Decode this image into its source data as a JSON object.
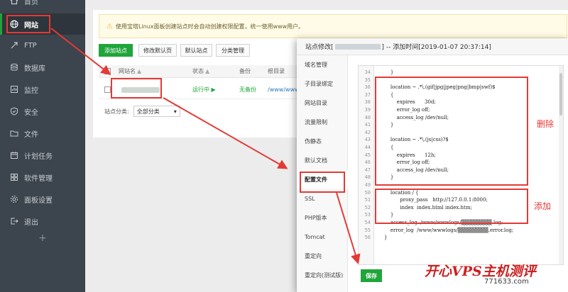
{
  "sidebar": {
    "items": [
      {
        "label": "首页",
        "icon": "home-icon"
      },
      {
        "label": "网站",
        "icon": "globe-icon"
      },
      {
        "label": "FTP",
        "icon": "ftp-icon"
      },
      {
        "label": "数据库",
        "icon": "database-icon"
      },
      {
        "label": "监控",
        "icon": "monitor-icon"
      },
      {
        "label": "安全",
        "icon": "shield-icon"
      },
      {
        "label": "文件",
        "icon": "folder-icon"
      },
      {
        "label": "计划任务",
        "icon": "calendar-icon"
      },
      {
        "label": "软件管理",
        "icon": "grid-icon"
      },
      {
        "label": "面板设置",
        "icon": "settings-icon"
      },
      {
        "label": "退出",
        "icon": "logout-icon"
      }
    ],
    "add_symbol": "+"
  },
  "main": {
    "notice": "使用宝塔Linux面板创建站点时会自动创建权限配置，统一使用www用户。",
    "toolbar": {
      "add_site": "添加站点",
      "edit_default_page": "修改默认页",
      "default_site": "默认站点",
      "category_manage": "分类管理"
    },
    "table": {
      "headers": {
        "name": "网站名",
        "status": "状态",
        "backup": "备份",
        "root": "根目录"
      },
      "row": {
        "status": "运行中 ▶",
        "backup": "无备份",
        "root": "/www/wwwr"
      }
    },
    "category": {
      "label": "站点分类:",
      "value": "全部分类"
    }
  },
  "modal": {
    "title_prefix": "站点修改[",
    "title_suffix": "] -- 添加时间[2019-01-07 20:37:14]",
    "tabs": [
      "域名管理",
      "子目录绑定",
      "网站目录",
      "流量限制",
      "伪静态",
      "默认文档",
      "配置文件",
      "SSL",
      "PHP版本",
      "Tomcat",
      "重定向",
      "重定向(测试版)"
    ],
    "active_tab": "配置文件",
    "save_label": "保存",
    "notes": {
      "delete": "删除",
      "add": "添加"
    },
    "code_lines": [
      {
        "n": "34",
        "t": "    }"
      },
      {
        "n": "35",
        "t": ""
      },
      {
        "n": "36",
        "t": "    location ~ .*\\.(gif|jpg|jpeg|png|bmp|swf)$"
      },
      {
        "n": "37",
        "t": "    {"
      },
      {
        "n": "38",
        "t": "        expires      30d;"
      },
      {
        "n": "39",
        "t": "        error_log off;"
      },
      {
        "n": "40",
        "t": "        access_log /dev/null;"
      },
      {
        "n": "41",
        "t": "    }"
      },
      {
        "n": "42",
        "t": ""
      },
      {
        "n": "43",
        "t": "    location ~ .*\\.(js|css)?$"
      },
      {
        "n": "44",
        "t": "    {"
      },
      {
        "n": "45",
        "t": "        expires      12h;"
      },
      {
        "n": "46",
        "t": "        error_log off;"
      },
      {
        "n": "47",
        "t": "        access_log /dev/null;"
      },
      {
        "n": "48",
        "t": "    }"
      },
      {
        "n": "49",
        "t": ""
      },
      {
        "n": "50",
        "t": "    location / {"
      },
      {
        "n": "51",
        "t": "          proxy_pass   http://127.0.0.1:8000;"
      },
      {
        "n": "52",
        "t": "          index  index.html index.htm;"
      },
      {
        "n": "53",
        "t": "    }"
      },
      {
        "n": "54",
        "t": "    access_log  /www/wwwlogs/▒▒▒▒▒▒▒▒.log;"
      },
      {
        "n": "55",
        "t": "    error_log  /www/wwwlogs/▒▒▒▒▒▒▒▒.error.log;"
      },
      {
        "n": "56",
        "t": "}"
      }
    ]
  },
  "watermark": {
    "main": "开心VPS主机测评",
    "sub": "771633.com"
  },
  "colors": {
    "sidebar": "#3c444d",
    "accent_green": "#20a53a",
    "annotation_red": "#e53935"
  }
}
